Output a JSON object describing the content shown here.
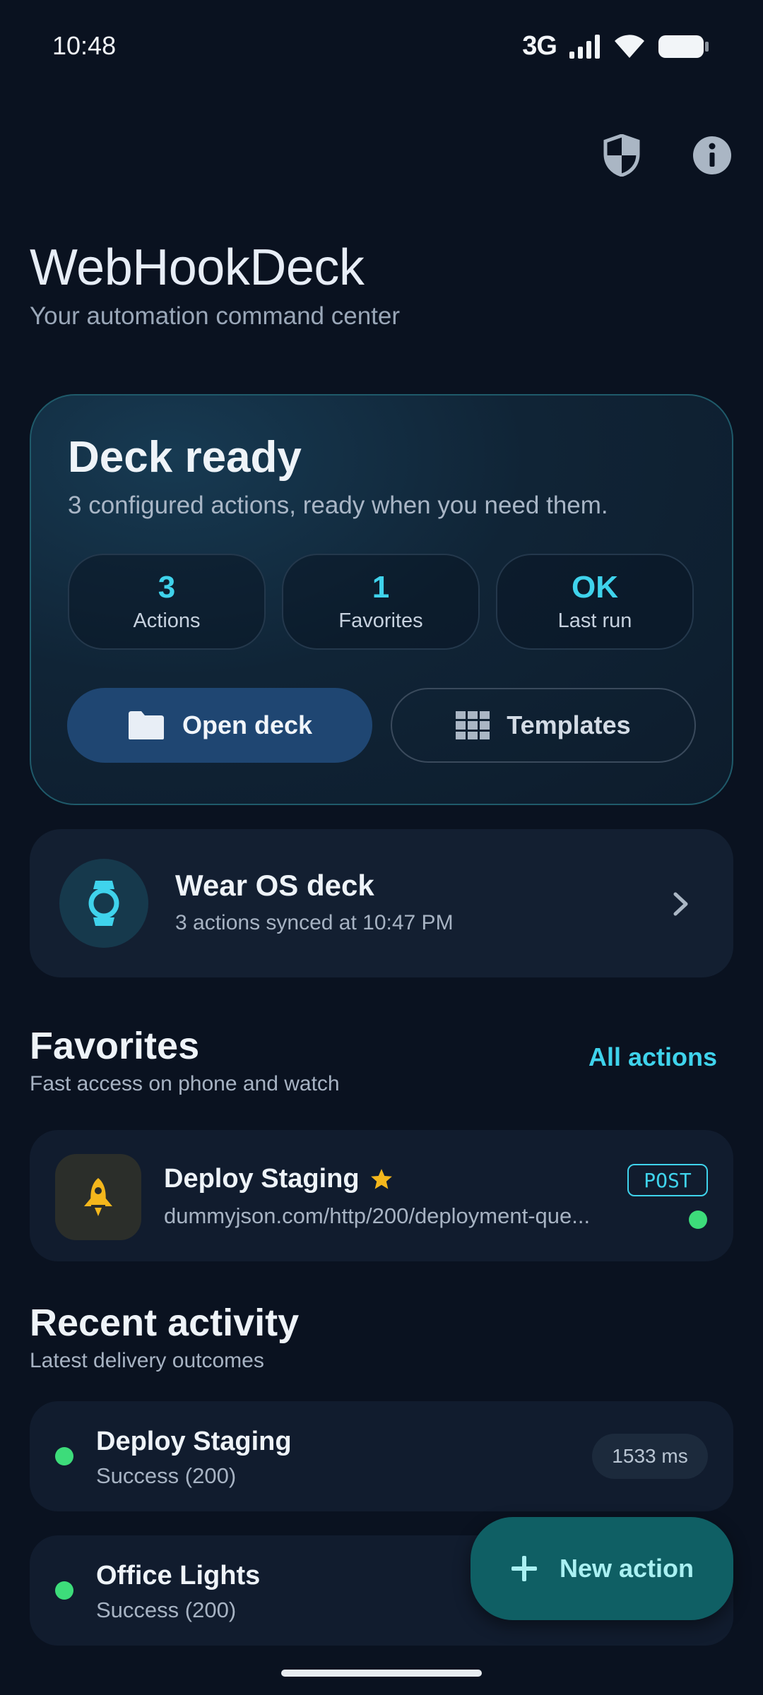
{
  "status_bar": {
    "time": "10:48",
    "network": "3G"
  },
  "header": {
    "title": "WebHookDeck",
    "subtitle": "Your automation command center"
  },
  "deck": {
    "title": "Deck ready",
    "subtitle": "3 configured actions, ready when you need them.",
    "stats": [
      {
        "value": "3",
        "label": "Actions"
      },
      {
        "value": "1",
        "label": "Favorites"
      },
      {
        "value": "OK",
        "label": "Last run"
      }
    ],
    "open_label": "Open deck",
    "templates_label": "Templates"
  },
  "wear": {
    "title": "Wear OS deck",
    "subtitle": "3 actions synced at 10:47 PM"
  },
  "favorites": {
    "title": "Favorites",
    "subtitle": "Fast access on phone and watch",
    "all_actions_label": "All actions",
    "items": [
      {
        "name": "Deploy Staging",
        "url": "dummyjson.com/http/200/deployment-que...",
        "method": "POST"
      }
    ]
  },
  "recent": {
    "title": "Recent activity",
    "subtitle": "Latest delivery outcomes",
    "items": [
      {
        "name": "Deploy Staging",
        "status": "Success (200)",
        "duration": "1533 ms"
      },
      {
        "name": "Office Lights",
        "status": "Success (200)"
      }
    ]
  },
  "fab": {
    "label": "New action"
  },
  "colors": {
    "accent": "#3fd3ec",
    "success": "#3ddc7a",
    "star": "#f4b71c",
    "background": "#0a1220"
  }
}
